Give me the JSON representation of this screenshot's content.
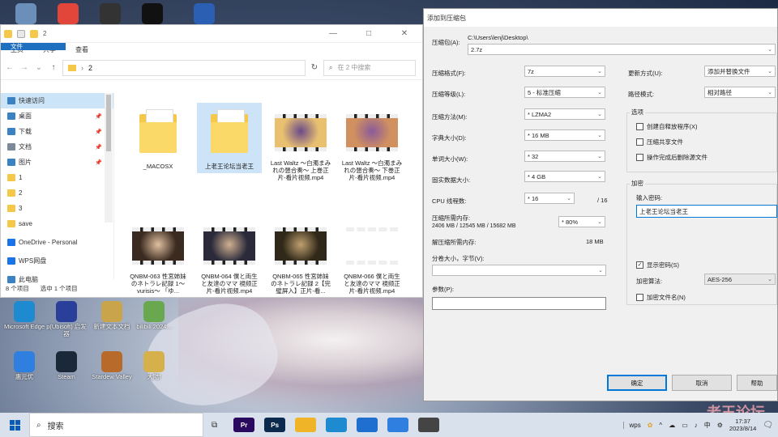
{
  "desktop": {
    "icons": [
      {
        "label": "",
        "icon": "recycle-bin-icon",
        "color": "#6a8fb8"
      },
      {
        "label": "",
        "icon": "chrome-icon",
        "color": "#e2463b"
      },
      {
        "label": "",
        "icon": "qq-icon",
        "color": "#333333"
      },
      {
        "label": "",
        "icon": "app-icon",
        "color": "#111111"
      },
      {
        "label": "",
        "icon": "word-doc-icon",
        "color": "#2b5fb4"
      },
      {
        "label": "Microsoft Edge",
        "icon": "edge-icon",
        "color": "#1e8bd1"
      },
      {
        "label": "p(Ubisoft) 启发器",
        "icon": "ubisoft-icon",
        "color": "#2a3f9a"
      },
      {
        "label": "新建文本文档",
        "icon": "text-doc-icon",
        "color": "#c9a44a"
      },
      {
        "label": "bilibili 2024...",
        "icon": "doc-icon",
        "color": "#6aa84f"
      },
      {
        "label": "惠元优",
        "icon": "app2-icon",
        "color": "#2f7fe0"
      },
      {
        "label": "Steam",
        "icon": "steam-icon",
        "color": "#1b2838"
      },
      {
        "label": "Stardew Valley",
        "icon": "stardew-icon",
        "color": "#b86a2a"
      },
      {
        "label": "大陆!",
        "icon": "file-icon",
        "color": "#d6b04a"
      }
    ],
    "watermark": "老王论坛"
  },
  "explorer": {
    "title": "2",
    "window_controls": [
      "—",
      "□",
      "✕"
    ],
    "ribbon_tabs": [
      "文件",
      "主页",
      "共享",
      "查看"
    ],
    "path": "2",
    "search_placeholder": "在 2 中搜索",
    "sidebar": [
      {
        "label": "快速访问",
        "icon": "star-icon",
        "color": "#3b82c4",
        "pinned": false,
        "selected": true
      },
      {
        "label": "桌面",
        "icon": "desktop-folder-icon",
        "color": "#3b82c4",
        "pinned": true
      },
      {
        "label": "下载",
        "icon": "download-icon",
        "color": "#3b82c4",
        "pinned": true
      },
      {
        "label": "文档",
        "icon": "documents-icon",
        "color": "#7b8a9a",
        "pinned": true
      },
      {
        "label": "图片",
        "icon": "pictures-icon",
        "color": "#3b82c4",
        "pinned": true
      },
      {
        "label": "1",
        "icon": "folder-icon",
        "color": "#f5c84a",
        "pinned": false
      },
      {
        "label": "2",
        "icon": "folder-icon",
        "color": "#f5c84a",
        "pinned": false
      },
      {
        "label": "3",
        "icon": "folder-icon",
        "color": "#f5c84a",
        "pinned": false
      },
      {
        "label": "save",
        "icon": "folder-icon",
        "color": "#f5c84a",
        "pinned": false
      },
      {
        "label": "OneDrive - Personal",
        "icon": "onedrive-icon",
        "color": "#1a73e8",
        "pinned": false
      },
      {
        "label": "WPS网盘",
        "icon": "wps-cloud-icon",
        "color": "#1a73e8",
        "pinned": false
      },
      {
        "label": "此电脑",
        "icon": "pc-icon",
        "color": "#3b82c4",
        "pinned": false
      }
    ],
    "files": [
      {
        "name": "_MACOSX",
        "kind": "folder"
      },
      {
        "name": "上老王论坛当老王",
        "kind": "folder",
        "selected": true
      },
      {
        "name": "Last Waltz ～白濁まみれの懇合奏～ 上巻正片-看片视频.mp4",
        "kind": "video"
      },
      {
        "name": "Last Waltz ～白濁まみれの懇合奏～ 下巻正片-看片视频.mp4",
        "kind": "video"
      },
      {
        "name": "QNBM-063 性宮姉妹のネトラレ記録 1～ vurisis～ 「ゆ...",
        "kind": "video"
      },
      {
        "name": "QNBM-064 僕と両生と友達のママ 視频正片-看片视频.mp4",
        "kind": "video"
      },
      {
        "name": "QNBM-065 性宮姉妹のネトラレ記録 2【完璧屏入】正片-看...",
        "kind": "video"
      },
      {
        "name": "QNBM-066 僕と両生と友達のママ 視频正片-看片视频.mp4",
        "kind": "video"
      }
    ],
    "status_count": "8 个项目",
    "status_selected": "选中 1 个项目"
  },
  "dialog": {
    "title": "添加到压缩包",
    "archive_label": "压缩包(A):",
    "archive_dir": "C:\\Users\\lenj\\Desktop\\",
    "archive_name": "2.7z",
    "format_label": "压缩格式(F):",
    "format_value": "7z",
    "level_label": "压缩等级(L):",
    "level_value": "5 - 标准压缩",
    "method_label": "压缩方法(M):",
    "method_value": "* LZMA2",
    "dict_label": "字典大小(D):",
    "dict_value": "* 16 MB",
    "word_label": "单词大小(W):",
    "word_value": "* 32",
    "solid_label": "固实数据大小:",
    "solid_value": "* 4 GB",
    "cpu_label": "CPU 线程数:",
    "cpu_value": "* 16",
    "cpu_total": "/ 16",
    "mem_label": "压缩所需内存:",
    "mem_detail": "2406 MB / 12545 MB / 15682 MB",
    "mem_value": "* 80%",
    "dmem_label": "解压缩所需内存:",
    "dmem_value": "18 MB",
    "split_label": "分卷大小，字节(V):",
    "params_label": "参数(P):",
    "update_label": "更新方式(U):",
    "update_value": "添加并替换文件",
    "path_label": "路径模式:",
    "path_value": "相对路径",
    "options_title": "选项",
    "opt_sfx": "创建自释放程序(X)",
    "opt_shared": "压缩共享文件",
    "opt_delete": "操作完成后删除源文件",
    "enc_title": "加密",
    "pwd_label": "输入密码:",
    "pwd_value": "上老王论坛当老王",
    "show_pwd": "显示密码(S)",
    "enc_method_label": "加密算法:",
    "enc_method_value": "AES-256",
    "enc_names": "加密文件名(N)",
    "btn_ok": "确定",
    "btn_cancel": "取消",
    "btn_help": "帮助"
  },
  "taskbar": {
    "search_label": "搜索",
    "apps": [
      {
        "label": "Pr",
        "color": "#2a0a5e"
      },
      {
        "label": "Ps",
        "color": "#0a2a4e"
      },
      {
        "label": "",
        "color": "#f0b429"
      },
      {
        "label": "",
        "color": "#1e8bd1"
      },
      {
        "label": "",
        "color": "#1f6fd1"
      },
      {
        "label": "",
        "color": "#2f7fe0"
      },
      {
        "label": "",
        "color": "#444444"
      }
    ],
    "wps_label": "wps",
    "ime": "中",
    "time": "17:37",
    "date": "2023/8/14"
  }
}
